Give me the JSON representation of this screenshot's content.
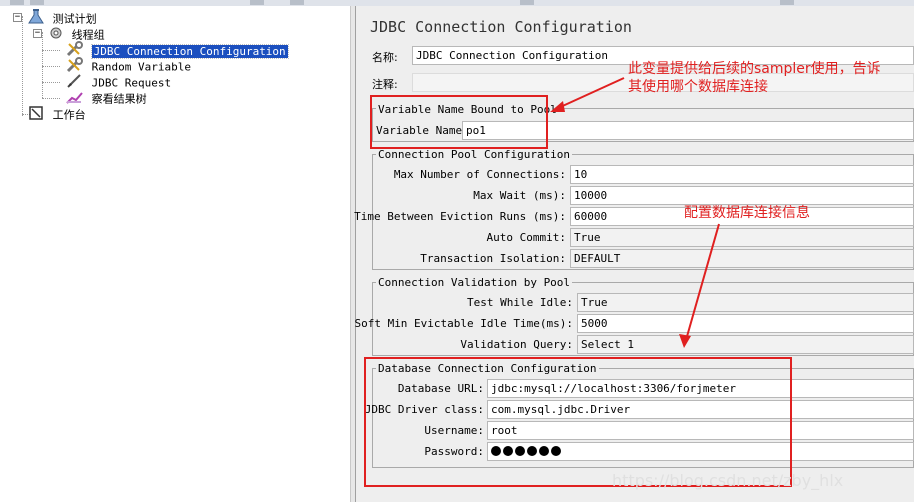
{
  "tree": {
    "items": [
      {
        "label": "测试计划",
        "icon": "test-plan-icon"
      },
      {
        "label": "线程组",
        "icon": "gear-icon"
      },
      {
        "label": "JDBC Connection Configuration",
        "icon": "wrench-icon",
        "selected": true
      },
      {
        "label": "Random Variable",
        "icon": "wrench-icon"
      },
      {
        "label": "JDBC Request",
        "icon": "pen-icon"
      },
      {
        "label": "察看结果树",
        "icon": "chart-icon"
      },
      {
        "label": "工作台",
        "icon": "workbench-icon"
      }
    ]
  },
  "config": {
    "title": "JDBC Connection Configuration",
    "name_label": "名称:",
    "name_value": "JDBC Connection Configuration",
    "comment_label": "注释:",
    "comment_value": "",
    "var_group": {
      "title": "Variable Name Bound to Pool",
      "var_label": "Variable Name:",
      "var_value": "po1"
    },
    "pool_group": {
      "title": "Connection Pool Configuration",
      "max_conn_label": "Max Number of Connections:",
      "max_conn_value": "10",
      "max_wait_label": "Max Wait (ms):",
      "max_wait_value": "10000",
      "evict_label": "Time Between Eviction Runs (ms):",
      "evict_value": "60000",
      "autocommit_label": "Auto Commit:",
      "autocommit_value": "True",
      "isolation_label": "Transaction Isolation:",
      "isolation_value": "DEFAULT"
    },
    "validation_group": {
      "title": "Connection Validation by Pool",
      "test_idle_label": "Test While Idle:",
      "test_idle_value": "True",
      "soft_min_label": "Soft Min Evictable Idle Time(ms):",
      "soft_min_value": "5000",
      "query_label": "Validation Query:",
      "query_value": "Select 1"
    },
    "db_group": {
      "title": "Database Connection Configuration",
      "url_label": "Database URL:",
      "url_value": "jdbc:mysql://localhost:3306/forjmeter",
      "driver_label": "JDBC Driver class:",
      "driver_value": "com.mysql.jdbc.Driver",
      "user_label": "Username:",
      "user_value": "root",
      "pass_label": "Password:",
      "pass_dots": 6
    }
  },
  "annotations": {
    "note1_line1": "此变量提供给后续的sampler使用，告诉",
    "note1_line2": "其使用哪个数据库连接",
    "note2": "配置数据库连接信息"
  },
  "watermark": "https://blog.csdn.net/zby_hlx",
  "colors": {
    "annotation_red": "#e02020",
    "selection_blue": "#1b4fbf"
  }
}
